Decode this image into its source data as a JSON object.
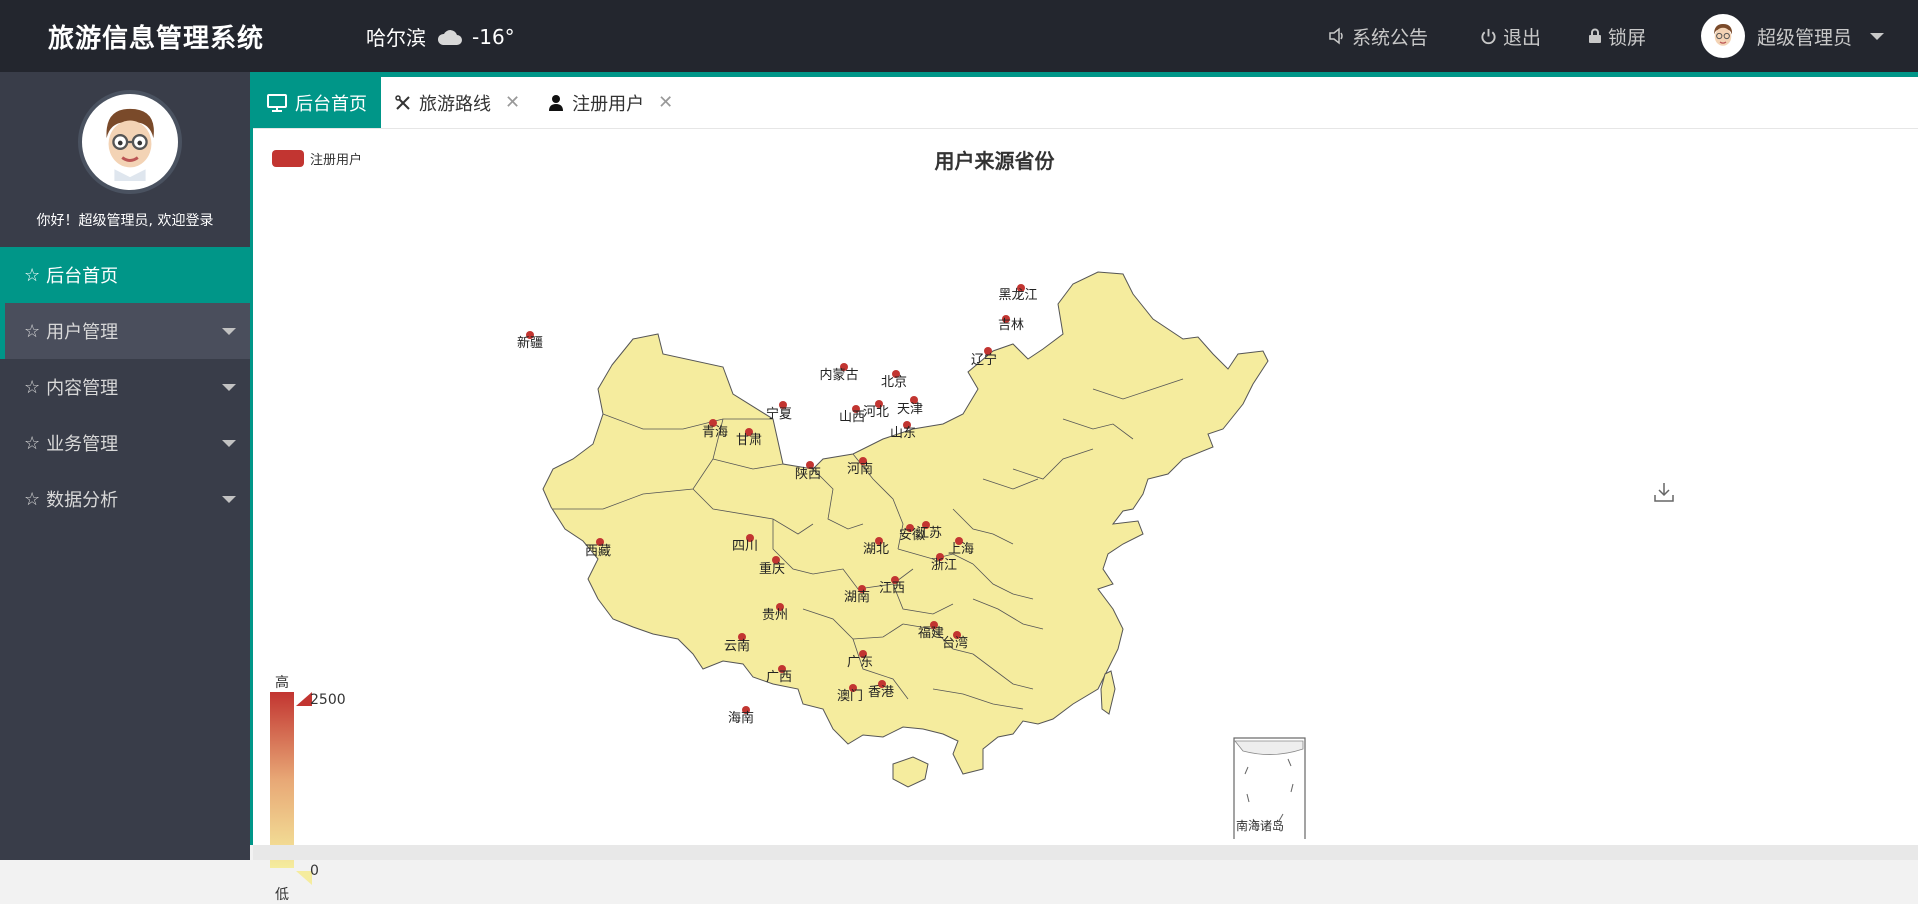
{
  "app": {
    "title": "旅游信息管理系统"
  },
  "weather": {
    "city": "哈尔滨",
    "temp": "-16°",
    "icon": "cloud-icon"
  },
  "topnav": {
    "announcement": "系统公告",
    "logout": "退出",
    "lock": "锁屏",
    "user": "超级管理员"
  },
  "sidebar": {
    "welcome": "你好！超级管理员, 欢迎登录",
    "items": [
      {
        "label": "后台首页",
        "icon": "star-icon"
      },
      {
        "label": "用户管理",
        "icon": "star-icon"
      },
      {
        "label": "内容管理",
        "icon": "star-icon"
      },
      {
        "label": "业务管理",
        "icon": "star-icon"
      },
      {
        "label": "数据分析",
        "icon": "star-icon"
      }
    ]
  },
  "tabs": [
    {
      "label": "后台首页",
      "icon": "monitor-icon"
    },
    {
      "label": "旅游路线",
      "icon": "tools-icon"
    },
    {
      "label": "注册用户",
      "icon": "user-icon"
    }
  ],
  "colors": {
    "accent": "#009688",
    "topbar": "#23262e",
    "sidebar": "#393d49",
    "series": "#c23531",
    "mapFill": "#f5ec9e"
  },
  "chart_data": {
    "type": "map",
    "title": "用户来源省份",
    "legend": [
      "注册用户"
    ],
    "visualMap": {
      "high_label": "高",
      "low_label": "低",
      "max": "2500",
      "min": "0"
    },
    "regions": [
      "黑龙江",
      "吉林",
      "辽宁",
      "内蒙古",
      "北京",
      "天津",
      "河北",
      "山西",
      "山东",
      "宁夏",
      "青海",
      "甘肃",
      "陕西",
      "河南",
      "新疆",
      "西藏",
      "四川",
      "重庆",
      "湖北",
      "安徽",
      "江苏",
      "上海",
      "浙江",
      "湖南",
      "江西",
      "贵州",
      "云南",
      "福建",
      "台湾",
      "广东",
      "广西",
      "澳门",
      "香港",
      "海南"
    ],
    "inset_label": "南海诸岛"
  }
}
